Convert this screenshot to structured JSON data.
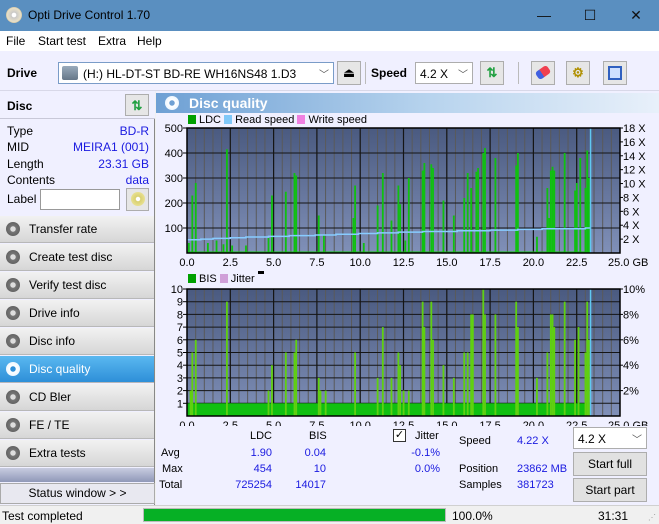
{
  "window": {
    "title": "Opti Drive Control 1.70",
    "minimize": "—",
    "maximize": "☐",
    "close": "✕"
  },
  "menu": [
    "File",
    "Start test",
    "Extra",
    "Help"
  ],
  "toolbar": {
    "drive_label": "Drive",
    "drive_value": "(H:)  HL-DT-ST BD-RE  WH16NS48 1.D3",
    "speed_label": "Speed",
    "speed_value": "4.2 X"
  },
  "disc": {
    "heading": "Disc",
    "fields": [
      {
        "key": "Type",
        "value": "BD-R"
      },
      {
        "key": "MID",
        "value": "MEIRA1 (001)"
      },
      {
        "key": "Length",
        "value": "23.31 GB"
      },
      {
        "key": "Contents",
        "value": "data"
      }
    ],
    "label_key": "Label",
    "label_value": ""
  },
  "nav": [
    {
      "label": "Transfer rate",
      "active": false
    },
    {
      "label": "Create test disc",
      "active": false
    },
    {
      "label": "Verify test disc",
      "active": false
    },
    {
      "label": "Drive info",
      "active": false
    },
    {
      "label": "Disc info",
      "active": false
    },
    {
      "label": "Disc quality",
      "active": true
    },
    {
      "label": "CD Bler",
      "active": false
    },
    {
      "label": "FE / TE",
      "active": false
    },
    {
      "label": "Extra tests",
      "active": false
    }
  ],
  "status_window_button": "Status window > >",
  "panel": {
    "title": "Disc quality"
  },
  "chart_data": [
    {
      "type": "bar",
      "title": "LDC",
      "legend": [
        {
          "name": "LDC",
          "color": "#00a000"
        },
        {
          "name": "Read speed",
          "color": "#80c8f8"
        },
        {
          "name": "Write speed",
          "color": "#f080e0"
        }
      ],
      "xlabel": "GB",
      "x_ticks": [
        "0.0",
        "2.5",
        "5.0",
        "7.5",
        "10.0",
        "12.5",
        "15.0",
        "17.5",
        "20.0",
        "22.5",
        "25.0 GB"
      ],
      "xlim": [
        0,
        25
      ],
      "y_ticks_left": [
        "500",
        "400",
        "300",
        "200",
        "100"
      ],
      "ylim_left": [
        0,
        500
      ],
      "y_ticks_right": [
        "18 X",
        "16 X",
        "14 X",
        "12 X",
        "10 X",
        "8 X",
        "6 X",
        "4 X",
        "2 X"
      ],
      "ylim_right": [
        0,
        18
      ],
      "grid": true,
      "ldc_spikes": [
        [
          0.3,
          230
        ],
        [
          0.5,
          280
        ],
        [
          0.1,
          40
        ],
        [
          1.2,
          40
        ],
        [
          1.7,
          50
        ],
        [
          2.1,
          35
        ],
        [
          2.3,
          415
        ],
        [
          2.6,
          30
        ],
        [
          3.4,
          30
        ],
        [
          4.7,
          60
        ],
        [
          4.9,
          230
        ],
        [
          5.7,
          245
        ],
        [
          6.2,
          320
        ],
        [
          6.3,
          310
        ],
        [
          7.6,
          150
        ],
        [
          7.9,
          70
        ],
        [
          9.6,
          140
        ],
        [
          9.7,
          270
        ],
        [
          10.2,
          40
        ],
        [
          11.0,
          190
        ],
        [
          11.3,
          320
        ],
        [
          11.8,
          130
        ],
        [
          12.2,
          270
        ],
        [
          12.3,
          195
        ],
        [
          12.6,
          50
        ],
        [
          12.8,
          300
        ],
        [
          13.6,
          330
        ],
        [
          13.7,
          360
        ],
        [
          14.1,
          355
        ],
        [
          14.2,
          340
        ],
        [
          14.8,
          210
        ],
        [
          15.4,
          150
        ],
        [
          16.0,
          220
        ],
        [
          16.2,
          320
        ],
        [
          16.4,
          260
        ],
        [
          16.7,
          325
        ],
        [
          16.8,
          340
        ],
        [
          17.1,
          400
        ],
        [
          17.2,
          420
        ],
        [
          17.8,
          380
        ],
        [
          19.0,
          350
        ],
        [
          19.1,
          400
        ],
        [
          20.2,
          65
        ],
        [
          20.8,
          260
        ],
        [
          20.9,
          140
        ],
        [
          21.0,
          330
        ],
        [
          21.1,
          345
        ],
        [
          21.2,
          330
        ],
        [
          21.8,
          400
        ],
        [
          22.4,
          250
        ],
        [
          22.5,
          280
        ],
        [
          22.7,
          380
        ],
        [
          23.0,
          260
        ],
        [
          23.1,
          410
        ],
        [
          23.2,
          300
        ]
      ],
      "read_speed_x": [
        [
          0,
          1.9
        ],
        [
          0.8,
          2.0
        ],
        [
          1.5,
          2.1
        ],
        [
          2.5,
          2.2
        ],
        [
          3.4,
          2.3
        ],
        [
          4.7,
          2.4
        ],
        [
          5.9,
          2.5
        ],
        [
          7.4,
          2.6
        ],
        [
          8.6,
          2.7
        ],
        [
          9.9,
          2.8
        ],
        [
          11.0,
          2.9
        ],
        [
          12.2,
          3.0
        ],
        [
          13.6,
          3.1
        ],
        [
          15.6,
          3.2
        ],
        [
          17.5,
          3.3
        ],
        [
          19.1,
          3.4
        ],
        [
          20.5,
          3.5
        ],
        [
          23.0,
          3.6
        ],
        [
          23.3,
          3.6
        ]
      ],
      "end_marker_gb": 23.3
    },
    {
      "type": "bar",
      "title": "BIS",
      "legend": [
        {
          "name": "BIS",
          "color": "#00a000"
        },
        {
          "name": "Jitter",
          "color": "#d0a0d8"
        }
      ],
      "xlabel": "GB",
      "x_ticks": [
        "0.0",
        "2.5",
        "5.0",
        "7.5",
        "10.0",
        "12.5",
        "15.0",
        "17.5",
        "20.0",
        "22.5",
        "25.0 GB"
      ],
      "xlim": [
        0,
        25
      ],
      "y_ticks_left": [
        "10",
        "9",
        "8",
        "7",
        "6",
        "5",
        "4",
        "3",
        "2",
        "1"
      ],
      "ylim_left": [
        0,
        10
      ],
      "y_ticks_right": [
        "10%",
        "8%",
        "6%",
        "4%",
        "2%"
      ],
      "ylim_right": [
        0,
        10
      ],
      "grid": true,
      "baseline_value": 1,
      "bis_spikes": [
        [
          0.2,
          2
        ],
        [
          0.3,
          5
        ],
        [
          0.5,
          6
        ],
        [
          2.3,
          9
        ],
        [
          4.7,
          2
        ],
        [
          4.9,
          4
        ],
        [
          5.7,
          5
        ],
        [
          6.2,
          5
        ],
        [
          6.3,
          6
        ],
        [
          7.6,
          3
        ],
        [
          7.7,
          2
        ],
        [
          8.0,
          2
        ],
        [
          9.7,
          5
        ],
        [
          11.0,
          3
        ],
        [
          11.3,
          7
        ],
        [
          11.8,
          3
        ],
        [
          12.2,
          5
        ],
        [
          12.3,
          4
        ],
        [
          12.5,
          2
        ],
        [
          12.8,
          2
        ],
        [
          13.6,
          9
        ],
        [
          13.7,
          7
        ],
        [
          14.1,
          9
        ],
        [
          14.2,
          6
        ],
        [
          14.8,
          4
        ],
        [
          15.4,
          3
        ],
        [
          16.0,
          5
        ],
        [
          16.2,
          5
        ],
        [
          16.4,
          8
        ],
        [
          16.5,
          8
        ],
        [
          17.1,
          10
        ],
        [
          17.2,
          8
        ],
        [
          17.8,
          8
        ],
        [
          19.0,
          9
        ],
        [
          19.1,
          7
        ],
        [
          20.2,
          3
        ],
        [
          20.8,
          5
        ],
        [
          21.0,
          8
        ],
        [
          21.1,
          8
        ],
        [
          21.2,
          7
        ],
        [
          21.8,
          9
        ],
        [
          22.4,
          6
        ],
        [
          22.6,
          7
        ],
        [
          23.0,
          5
        ],
        [
          23.1,
          9
        ],
        [
          23.2,
          6
        ]
      ],
      "end_marker_gb": 23.3
    }
  ],
  "stats": {
    "col_ldc": "LDC",
    "col_bis": "BIS",
    "jitter_label": "Jitter",
    "jitter_checked": true,
    "rows": [
      {
        "label": "Avg",
        "ldc": "1.90",
        "bis": "0.04",
        "jitter": "-0.1%"
      },
      {
        "label": "Max",
        "ldc": "454",
        "bis": "10",
        "jitter": "0.0%"
      },
      {
        "label": "Total",
        "ldc": "725254",
        "bis": "14017",
        "jitter": ""
      }
    ],
    "speed_label": "Speed",
    "speed_value": "4.22 X",
    "position_label": "Position",
    "position_value": "23862 MB",
    "samples_label": "Samples",
    "samples_value": "381723",
    "speed_select": "4.2 X",
    "start_full": "Start full",
    "start_part": "Start part"
  },
  "status": {
    "text": "Test completed",
    "progress": 1.0,
    "progress_text": "100.0%",
    "time": "31:31"
  }
}
